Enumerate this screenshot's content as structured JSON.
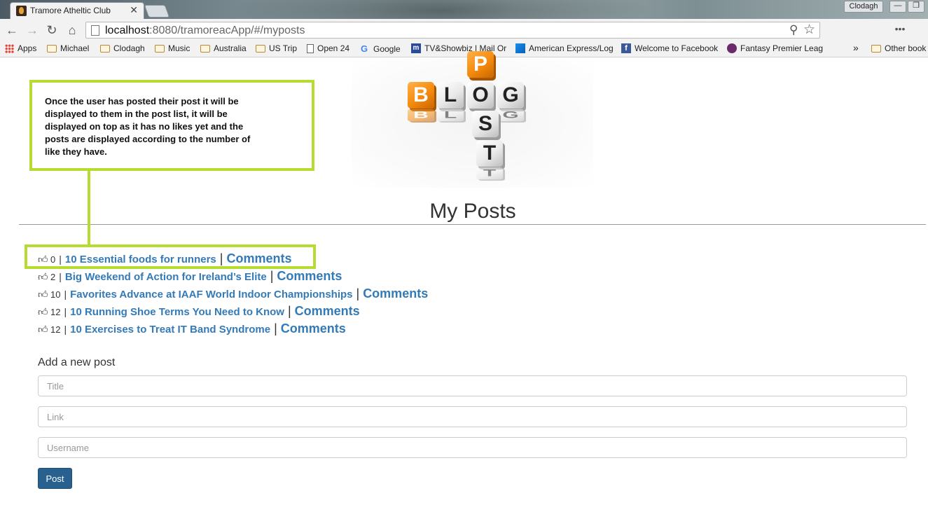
{
  "browser": {
    "tab_title": "Tramore Atheltic Club",
    "tab_close": "✕",
    "profile": "Clodagh",
    "url_host": "localhost",
    "url_rest": ":8080/tramoreacApp/#/myposts",
    "bookmarks": [
      {
        "label": "Apps",
        "icon": "apps-icon"
      },
      {
        "label": "Michael",
        "icon": "folder-icon"
      },
      {
        "label": "Clodagh",
        "icon": "folder-icon"
      },
      {
        "label": "Music",
        "icon": "folder-icon"
      },
      {
        "label": "Australia",
        "icon": "folder-icon"
      },
      {
        "label": "US Trip",
        "icon": "folder-icon"
      },
      {
        "label": "Open 24",
        "icon": "page-icon"
      },
      {
        "label": "Google",
        "icon": "google-icon"
      },
      {
        "label": "TV&Showbiz | Mail Or",
        "icon": "mail-online-icon"
      },
      {
        "label": "American Express/Log",
        "icon": "amex-icon"
      },
      {
        "label": "Welcome to Facebook",
        "icon": "facebook-icon"
      },
      {
        "label": "Fantasy Premier Leag",
        "icon": "premier-league-icon"
      },
      {
        "label": "Other book",
        "icon": "folder-icon"
      }
    ],
    "more_bookmarks": "»"
  },
  "page": {
    "title": "My Posts",
    "logo_letters": "BLOG POST",
    "posts": [
      {
        "likes": "0",
        "title": "10 Essential foods for runners",
        "comments": "Comments"
      },
      {
        "likes": "2",
        "title": "Big Weekend of Action for Ireland’s Elite",
        "comments": "Comments"
      },
      {
        "likes": "10",
        "title": "Favorites Advance at IAAF World Indoor Championships",
        "comments": "Comments"
      },
      {
        "likes": "12",
        "title": "10 Running Shoe Terms You Need to Know",
        "comments": "Comments"
      },
      {
        "likes": "12",
        "title": "10 Exercises to Treat IT Band Syndrome",
        "comments": "Comments"
      }
    ],
    "separator": "|",
    "new_post": {
      "heading": "Add a new post",
      "title_placeholder": "Title",
      "link_placeholder": "Link",
      "username_placeholder": "Username",
      "submit_label": "Post"
    }
  },
  "annotation": {
    "text": "Once the user has posted their post it will be displayed to them in the post list, it will be displayed on top as it has no likes yet and the posts are displayed according to the number of like they have.",
    "color": "#b6dc32"
  },
  "colors": {
    "link": "#337ab7",
    "button": "#286090",
    "logo_orange": "#f58a0c"
  }
}
